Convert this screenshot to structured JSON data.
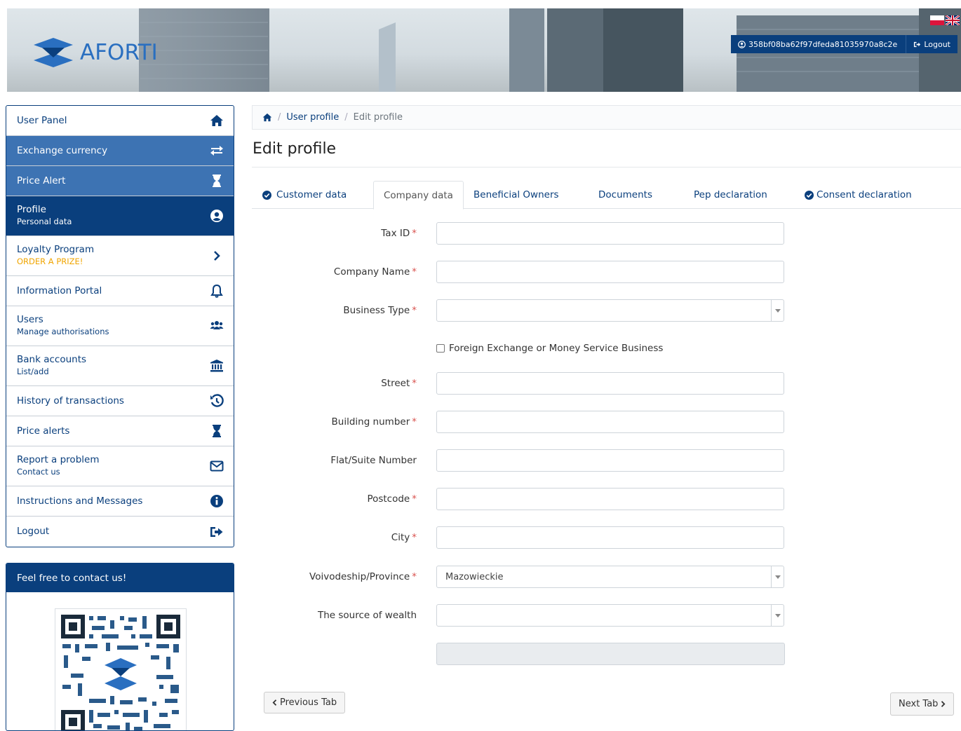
{
  "header": {
    "brand": "AFORTI",
    "user_id": "358bf08ba62f97dfeda81035970a8c2e",
    "logout_label": "Logout",
    "flags": [
      "pl",
      "uk"
    ]
  },
  "sidebar": {
    "items": [
      {
        "label": "User Panel",
        "sub": "",
        "icon": "home-icon",
        "style": "plain"
      },
      {
        "label": "Exchange currency",
        "sub": "",
        "icon": "exchange-arrows-icon",
        "style": "mid"
      },
      {
        "label": "Price Alert",
        "sub": "",
        "icon": "hourglass-icon",
        "style": "mid"
      },
      {
        "label": "Profile",
        "sub": "Personal data",
        "icon": "user-circle-icon",
        "style": "dark"
      },
      {
        "label": "Loyalty Program",
        "sub": "ORDER A PRIZE!",
        "icon": "chevron-right-icon",
        "style": "plain"
      },
      {
        "label": "Information Portal",
        "sub": "",
        "icon": "bell-icon",
        "style": "plain"
      },
      {
        "label": "Users",
        "sub": "Manage authorisations",
        "icon": "users-icon",
        "style": "plain"
      },
      {
        "label": "Bank accounts",
        "sub": "List/add",
        "icon": "bank-icon",
        "style": "plain"
      },
      {
        "label": "History of transactions",
        "sub": "",
        "icon": "history-icon",
        "style": "plain"
      },
      {
        "label": "Price alerts",
        "sub": "",
        "icon": "hourglass-icon",
        "style": "plain"
      },
      {
        "label": "Report a problem",
        "sub": "Contact us",
        "icon": "envelope-icon",
        "style": "plain"
      },
      {
        "label": "Instructions and Messages",
        "sub": "",
        "icon": "info-icon",
        "style": "plain"
      },
      {
        "label": "Logout",
        "sub": "",
        "icon": "sign-out-icon",
        "style": "plain"
      }
    ],
    "contact_title": "Feel free to contact us!"
  },
  "breadcrumb": {
    "level1": "User profile",
    "level2": "Edit profile"
  },
  "page_title": "Edit profile",
  "tabs": [
    {
      "label": "Customer data",
      "checked": true
    },
    {
      "label": "Company data",
      "active": true
    },
    {
      "label": "Beneficial Owners"
    },
    {
      "label": "Documents"
    },
    {
      "label": "Pep declaration"
    },
    {
      "label": "Consent declaration",
      "checked": true
    }
  ],
  "form": {
    "tax_id": {
      "label": "Tax ID",
      "value": ""
    },
    "company_name": {
      "label": "Company Name",
      "value": ""
    },
    "business_type": {
      "label": "Business Type",
      "value": ""
    },
    "fx_checkbox": {
      "label": "Foreign Exchange or Money Service Business",
      "checked": false
    },
    "street": {
      "label": "Street",
      "value": ""
    },
    "building_number": {
      "label": "Building number",
      "value": ""
    },
    "flat_number": {
      "label": "Flat/Suite Number",
      "value": ""
    },
    "postcode": {
      "label": "Postcode",
      "value": ""
    },
    "city": {
      "label": "City",
      "value": ""
    },
    "province": {
      "label": "Voivodeship/Province",
      "value": "Mazowieckie"
    },
    "wealth_source": {
      "label": "The source of wealth",
      "value": ""
    }
  },
  "buttons": {
    "previous": "Previous Tab",
    "next": "Next Tab"
  },
  "colors": {
    "primary": "#0a3f7d",
    "mid": "#3d73b3",
    "gold": "#f0a500",
    "required": "#d9534f"
  }
}
